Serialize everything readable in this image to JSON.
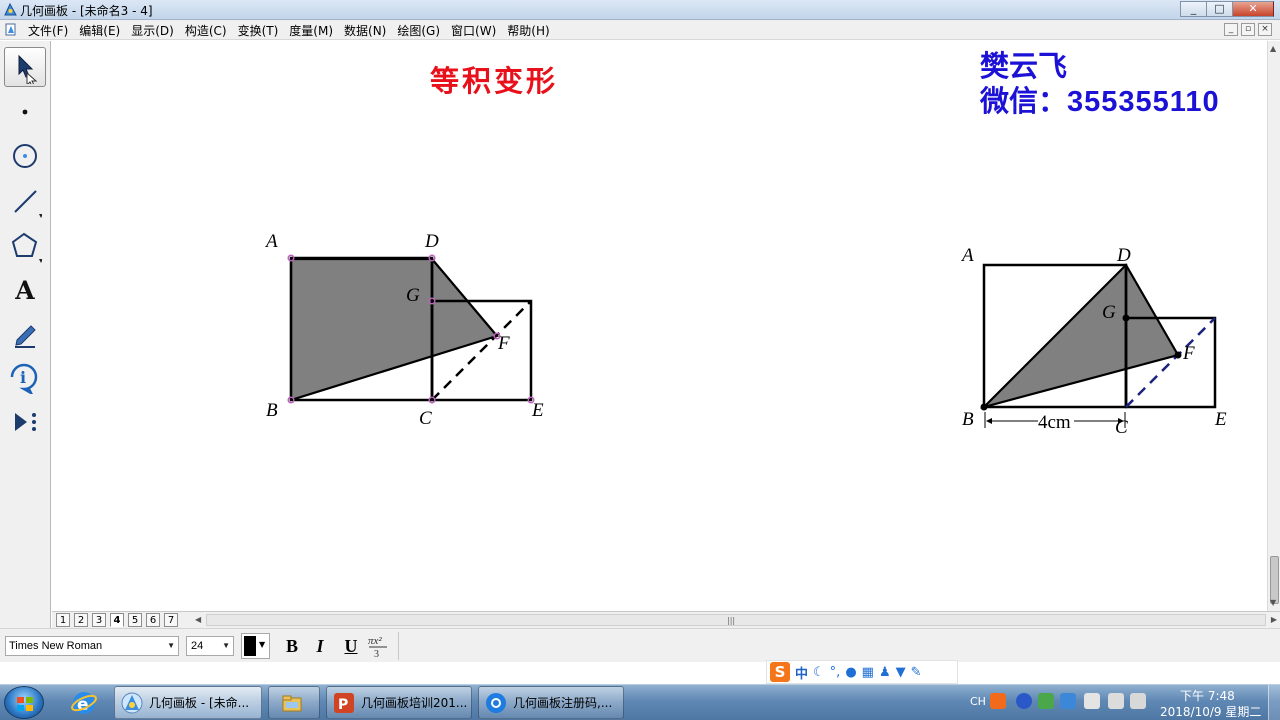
{
  "window": {
    "title": "几何画板 - [未命名3 - 4]",
    "buttons": {
      "minimize": "_",
      "maximize": "□",
      "close": "✕"
    }
  },
  "menubar": {
    "items": [
      "文件(F)",
      "编辑(E)",
      "显示(D)",
      "构造(C)",
      "变换(T)",
      "度量(M)",
      "数据(N)",
      "绘图(G)",
      "窗口(W)",
      "帮助(H)"
    ],
    "mdi_buttons": [
      "_",
      "▫",
      "×"
    ]
  },
  "toolbox": {
    "tools": [
      "arrow-select-tool",
      "point-tool",
      "compass-tool",
      "straightedge-tool",
      "polygon-tool",
      "text-tool",
      "marker-tool",
      "information-tool",
      "custom-tool"
    ],
    "text_tool_glyph": "A"
  },
  "canvas": {
    "heading": "等积变形",
    "author_name": "樊云飞",
    "wechat_label": "微信：",
    "wechat_number": "355355110",
    "left_figure": {
      "labels": {
        "A": "A",
        "B": "B",
        "C": "C",
        "D": "D",
        "E": "E",
        "F": "F",
        "G": "G"
      }
    },
    "right_figure": {
      "labels": {
        "A": "A",
        "B": "B",
        "C": "C",
        "D": "D",
        "E": "E",
        "F": "F",
        "G": "G"
      },
      "measure_label": "4cm"
    },
    "colors": {
      "heading": "#e8101a",
      "author": "#1c12d6",
      "shade": "#808080",
      "point_left": "#c060c0",
      "dash_right": "#1a237e"
    }
  },
  "pagebar": {
    "tabs": [
      "1",
      "2",
      "3",
      "4",
      "5",
      "6",
      "7"
    ],
    "active_tab": "4"
  },
  "textbar": {
    "font_family": "Times New Roman",
    "font_size": "24",
    "bold": "B",
    "italic": "I",
    "underline": "U"
  },
  "ime": {
    "logo": "S",
    "mode": "中"
  },
  "taskbar": {
    "buttons": [
      {
        "label": "几何画板 - [未命..."
      },
      {
        "label": ""
      },
      {
        "label": "几何画板培训201..."
      },
      {
        "label": "几何画板注册码,..."
      }
    ],
    "tray": {
      "lang": "CH",
      "time": "下午 7:48",
      "date": "2018/10/9 星期二"
    }
  }
}
